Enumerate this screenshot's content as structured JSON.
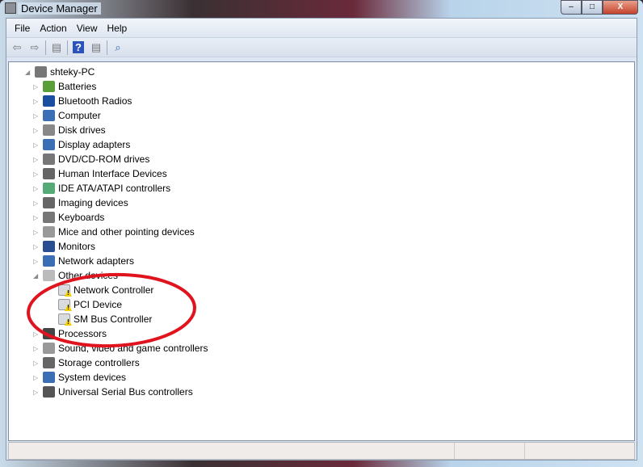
{
  "window": {
    "title": "Device Manager",
    "minimize": "–",
    "maximize": "□",
    "close": "X"
  },
  "menu": [
    "File",
    "Action",
    "View",
    "Help"
  ],
  "toolbar": [
    {
      "icon": "back-arrow-icon",
      "glyph": "⇦"
    },
    {
      "icon": "forward-arrow-icon",
      "glyph": "⇨"
    },
    {
      "icon": "show-hide-console-tree-icon",
      "glyph": "▤"
    },
    {
      "icon": "help-icon",
      "glyph": "?"
    },
    {
      "icon": "show-action-pane-icon",
      "glyph": "▤"
    },
    {
      "icon": "scan-hardware-icon",
      "glyph": "⌕"
    }
  ],
  "tree": {
    "root": "shteky-PC",
    "categories": [
      "Batteries",
      "Bluetooth Radios",
      "Computer",
      "Disk drives",
      "Display adapters",
      "DVD/CD-ROM drives",
      "Human Interface Devices",
      "IDE ATA/ATAPI controllers",
      "Imaging devices",
      "Keyboards",
      "Mice and other pointing devices",
      "Monitors",
      "Network adapters",
      "Other devices",
      "Processors",
      "Sound, video and game controllers",
      "Storage controllers",
      "System devices",
      "Universal Serial Bus controllers"
    ],
    "other_devices": [
      "Network Controller",
      "PCI Device",
      "SM Bus Controller"
    ]
  },
  "colors": {
    "annotation": "#e0141e",
    "warning": "#f5d000"
  }
}
